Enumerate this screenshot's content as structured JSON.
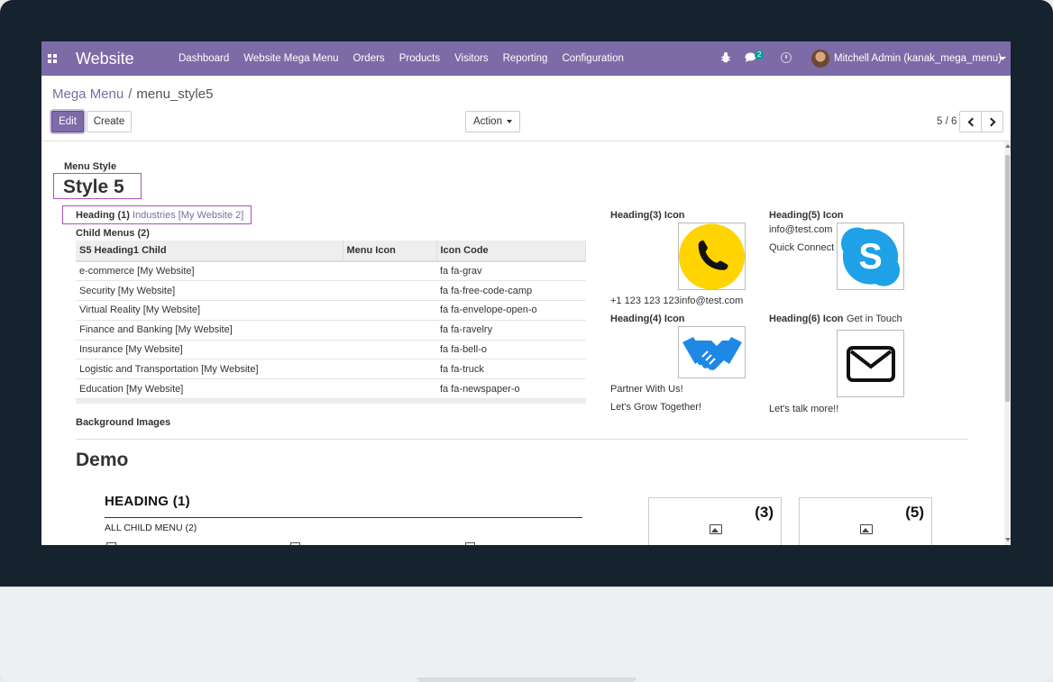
{
  "navbar": {
    "brand": "Website",
    "menu": [
      "Dashboard",
      "Website Mega Menu",
      "Orders",
      "Products",
      "Visitors",
      "Reporting",
      "Configuration"
    ],
    "chat_count": "2",
    "user": "Mitchell Admin (kanak_mega_menu)"
  },
  "breadcrumb": {
    "parent": "Mega Menu",
    "separator": "/",
    "current": "menu_style5"
  },
  "toolbar": {
    "edit": "Edit",
    "create": "Create",
    "action": "Action",
    "pager": "5 / 6"
  },
  "form": {
    "menu_style_label": "Menu Style",
    "menu_style_value": "Style 5",
    "heading1_label": "Heading (1)",
    "heading1_value": "Industries [My Website 2]",
    "child_menus_label": "Child Menus (2)",
    "table": {
      "columns": [
        "S5 Heading1 Child",
        "Menu Icon",
        "Icon Code"
      ],
      "rows": [
        [
          "e-commerce [My Website]",
          "",
          "fa fa-grav"
        ],
        [
          "Security [My Website]",
          "",
          "fa fa-free-code-camp"
        ],
        [
          "Virtual Reality [My Website]",
          "",
          "fa fa-envelope-open-o"
        ],
        [
          "Finance and Banking [My Website]",
          "",
          "fa fa-ravelry"
        ],
        [
          "Insurance [My Website]",
          "",
          "fa fa-bell-o"
        ],
        [
          "Logistic and Transportation [My Website]",
          "",
          "fa fa-truck"
        ],
        [
          "Education [My Website]",
          "",
          "fa fa-newspaper-o"
        ]
      ]
    },
    "heading3_label": "Heading(3) Icon",
    "heading3_text": "+1 123 123 123info@test.com",
    "heading4_label": "Heading(4) Icon",
    "heading4_line1": "Partner With Us!",
    "heading4_line2": "Let's Grow Together!",
    "heading5_label": "Heading(5) Icon",
    "heading5_line1": "info@test.com",
    "heading5_line2": "Quick Connect",
    "heading6_label": "Heading(6) Icon",
    "heading6_title": "Get in Touch",
    "heading6_text": "Let's talk more!!",
    "background_images_label": "Background Images"
  },
  "demo": {
    "title": "Demo",
    "heading": "HEADING (1)",
    "sub": "ALL CHILD MENU  (2)",
    "card3": "(3)",
    "card5": "(5)"
  },
  "colors": {
    "primary": "#7c6ba6",
    "highlight_box": "#b04fbf",
    "phone_bg": "#ffd400",
    "skype": "#1ea1e6",
    "handshake": "#1e88e5"
  }
}
